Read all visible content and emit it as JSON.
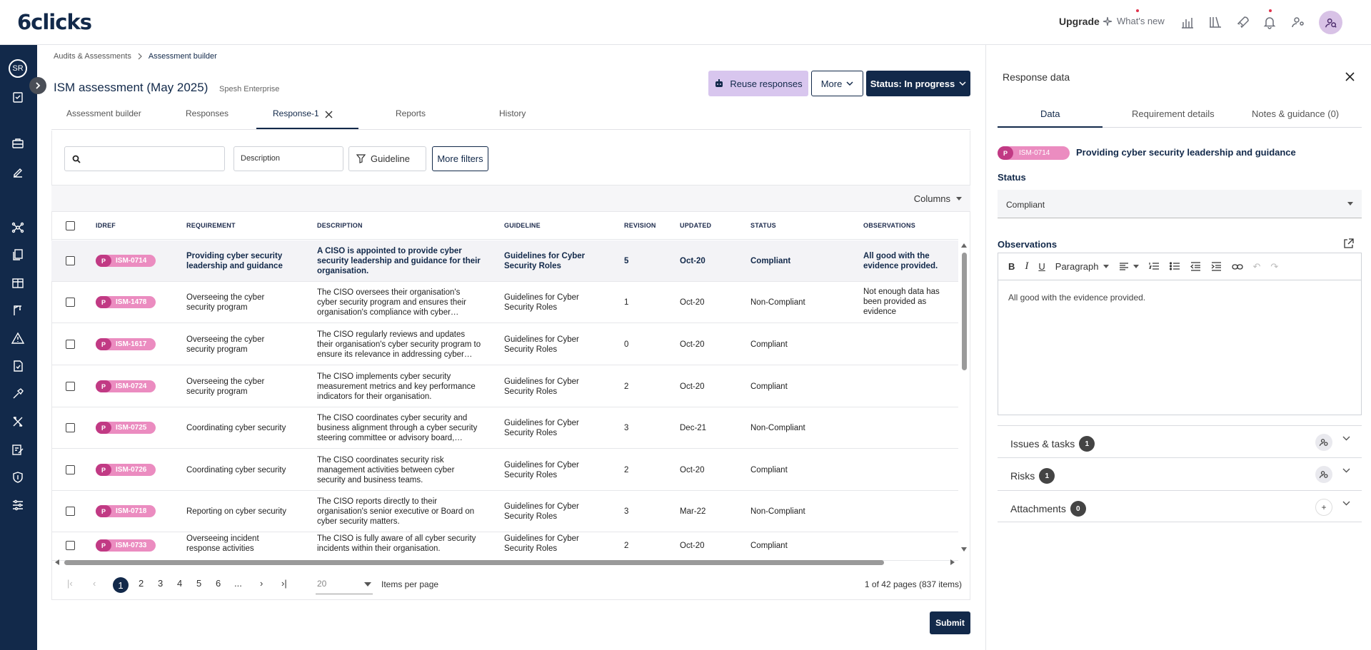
{
  "brand": {
    "logo": "6clicks"
  },
  "topnav": {
    "upgrade": "Upgrade",
    "whats_new": "What's new"
  },
  "sidebar": {
    "user_initials": "SR"
  },
  "breadcrumb": {
    "root": "Audits & Assessments",
    "current": "Assessment builder"
  },
  "page": {
    "title": "ISM assessment (May 2025)",
    "org": "Spesh Enterprise"
  },
  "actions": {
    "reuse": "Reuse responses",
    "more": "More",
    "status": "Status: In progress"
  },
  "tabs": [
    {
      "label": "Assessment builder"
    },
    {
      "label": "Responses"
    },
    {
      "label": "Response-1"
    },
    {
      "label": "Reports"
    },
    {
      "label": "History"
    }
  ],
  "filters": {
    "description": "Description",
    "guideline": "Guideline",
    "more_filters": "More filters",
    "columns": "Columns"
  },
  "table": {
    "headers": {
      "idref": "IDREF",
      "requirement": "REQUIREMENT",
      "description": "DESCRIPTION",
      "guideline": "GUIDELINE",
      "revision": "REVISION",
      "updated": "UPDATED",
      "status": "STATUS",
      "observations": "OBSERVATIONS"
    },
    "rows": [
      {
        "p": "P",
        "id": "ISM-0714",
        "req": "Providing cyber security leadership and guidance",
        "desc": "A CISO is appointed to provide cyber security leadership and guidance for their organisation.",
        "guideline": "Guidelines for Cyber Security Roles",
        "rev": "5",
        "updated": "Oct-20",
        "status": "Compliant",
        "obs": "All good with the evidence provided."
      },
      {
        "p": "P",
        "id": "ISM-1478",
        "req": "Overseeing the cyber security program",
        "desc": "The CISO oversees their organisation's cyber security program and ensures their organisation's compliance with cyber…",
        "guideline": "Guidelines for Cyber Security Roles",
        "rev": "1",
        "updated": "Oct-20",
        "status": "Non-Compliant",
        "obs": "Not enough data has been provided as evidence"
      },
      {
        "p": "P",
        "id": "ISM-1617",
        "req": "Overseeing the cyber security program",
        "desc": "The CISO regularly reviews and updates their organisation's cyber security program to ensure its relevance in addressing cyber…",
        "guideline": "Guidelines for Cyber Security Roles",
        "rev": "0",
        "updated": "Oct-20",
        "status": "Compliant",
        "obs": ""
      },
      {
        "p": "P",
        "id": "ISM-0724",
        "req": "Overseeing the cyber security program",
        "desc": "The CISO implements cyber security measurement metrics and key performance indicators for their organisation.",
        "guideline": "Guidelines for Cyber Security Roles",
        "rev": "2",
        "updated": "Oct-20",
        "status": "Compliant",
        "obs": ""
      },
      {
        "p": "P",
        "id": "ISM-0725",
        "req": "Coordinating cyber security",
        "desc": "The CISO coordinates cyber security and business alignment through a cyber security steering committee or advisory board,…",
        "guideline": "Guidelines for Cyber Security Roles",
        "rev": "3",
        "updated": "Dec-21",
        "status": "Non-Compliant",
        "obs": ""
      },
      {
        "p": "P",
        "id": "ISM-0726",
        "req": "Coordinating cyber security",
        "desc": "The CISO coordinates security risk management activities between cyber security and business teams.",
        "guideline": "Guidelines for Cyber Security Roles",
        "rev": "2",
        "updated": "Oct-20",
        "status": "Compliant",
        "obs": ""
      },
      {
        "p": "P",
        "id": "ISM-0718",
        "req": "Reporting on cyber security",
        "desc": "The CISO reports directly to their organisation's senior executive or Board on cyber security matters.",
        "guideline": "Guidelines for Cyber Security Roles",
        "rev": "3",
        "updated": "Mar-22",
        "status": "Non-Compliant",
        "obs": ""
      },
      {
        "p": "P",
        "id": "ISM-0733",
        "req": "Overseeing incident response activities",
        "desc": "The CISO is fully aware of all cyber security incidents within their organisation.",
        "guideline": "Guidelines for Cyber Security Roles",
        "rev": "2",
        "updated": "Oct-20",
        "status": "Compliant",
        "obs": ""
      }
    ]
  },
  "pagination": {
    "pages": [
      "1",
      "2",
      "3",
      "4",
      "5",
      "6",
      "..."
    ],
    "per_page": "20",
    "per_page_label": "Items per page",
    "summary": "1 of 42 pages (837 items)"
  },
  "submit": "Submit",
  "response_panel": {
    "title": "Response data",
    "tabs": [
      "Data",
      "Requirement details",
      "Notes & guidance (0)"
    ],
    "req_p": "P",
    "req_id": "ISM-0714",
    "req_title": "Providing cyber security leadership and guidance",
    "status_label": "Status",
    "status_value": "Compliant",
    "obs_label": "Observations",
    "paragraph": "Paragraph",
    "obs_text": "All good with the evidence provided.",
    "issues": {
      "label": "Issues & tasks",
      "count": "1"
    },
    "risks": {
      "label": "Risks",
      "count": "1"
    },
    "attachments": {
      "label": "Attachments",
      "count": "0"
    }
  },
  "colors": {
    "navy": "#12294a",
    "badge_pink": "#eb8cc0",
    "badge_dark": "#c13a84",
    "reuse_bg": "#d8c6ee"
  }
}
